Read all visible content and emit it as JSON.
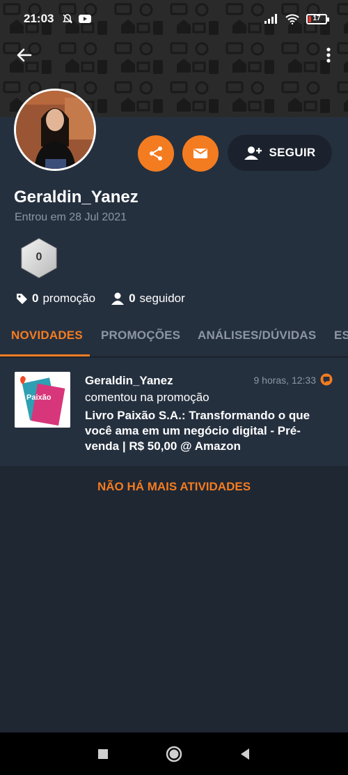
{
  "status_bar": {
    "time": "21:03",
    "battery": "17",
    "icons": [
      "bell-off-icon",
      "youtube-icon",
      "signal-icon",
      "wifi-icon",
      "battery-icon"
    ]
  },
  "colors": {
    "accent": "#f47c20",
    "panel": "#25303f",
    "background": "#1f2733",
    "muted": "#8d96a3"
  },
  "profile": {
    "username": "Geraldin_Yanez",
    "joined": "Entrou em 28 Jul 2021",
    "level": "0",
    "follow_label": "SEGUIR",
    "stats": {
      "promotions_count": "0",
      "promotions_label": "promoção",
      "followers_count": "0",
      "followers_label": "seguidor"
    }
  },
  "tabs": [
    {
      "label": "NOVIDADES",
      "active": true
    },
    {
      "label": "PROMOÇÕES",
      "active": false
    },
    {
      "label": "ANÁLISES/DÚVIDAS",
      "active": false
    },
    {
      "label": "ES",
      "active": false
    }
  ],
  "activity": {
    "user": "Geraldin_Yanez",
    "time": "9 horas, 12:33",
    "verb": "comentou na promoção",
    "title": "Livro Paixão S.A.: Transformando o que você ama em um negócio digital - Pré-venda | R$ 50,00 @ Amazon",
    "thumb_text": "Paixão"
  },
  "footer": {
    "no_more": "NÃO HÁ MAIS ATIVIDADES"
  }
}
